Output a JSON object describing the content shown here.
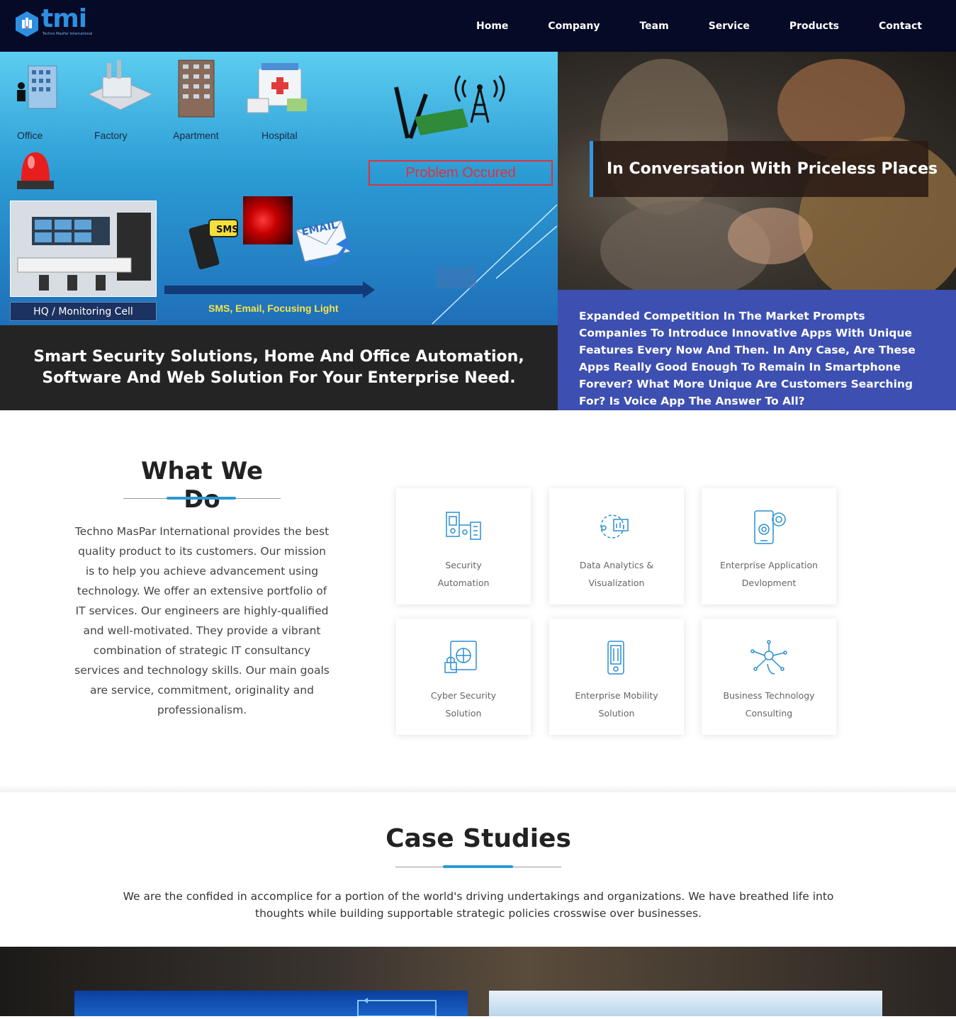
{
  "nav": {
    "logo_text": "tmi",
    "logo_tagline": "Techno MasPar International",
    "items": [
      {
        "label": "Home"
      },
      {
        "label": "Company"
      },
      {
        "label": "Team"
      },
      {
        "label": "Service"
      },
      {
        "label": "Products"
      },
      {
        "label": "Contact"
      }
    ]
  },
  "hero": {
    "diagram": {
      "buildings": [
        "Office",
        "Factory",
        "Apartment",
        "Hospital"
      ],
      "problem": "Problem Occured",
      "hq_label": "HQ / Monitoring Cell",
      "sms": "SMS",
      "email": "EMAIL",
      "alert_label": "SMS, Email, Focusing Light"
    },
    "caption": "Smart Security Solutions, Home And Office Automation, Software And Web Solution For Your Enterprise Need.",
    "side_title": "In Conversation With Priceless Places",
    "side_text": "Expanded Competition In The Market Prompts Companies To Introduce Innovative Apps With Unique Features Every Now And Then. In Any Case, Are These Apps Really Good Enough To Remain In Smartphone Forever? What More Unique Are Customers Searching For? Is Voice App The Answer To All?"
  },
  "what_we_do": {
    "title": "What We Do",
    "text": "Techno MasPar International provides the best quality product to its customers. Our mission is to help you achieve advancement using technology. We offer an extensive portfolio of IT services. Our engineers are highly-qualified and well-motivated. They provide a vibrant combination of strategic IT consultancy services and technology skills. Our main goals are service, commitment, originality and professionalism.",
    "services": [
      {
        "line1": "Security",
        "line2": "Automation",
        "icon": "security-automation-icon"
      },
      {
        "line1": "Data Analytics &",
        "line2": "Visualization",
        "icon": "data-analytics-icon"
      },
      {
        "line1": "Enterprise Application",
        "line2": "Devlopment",
        "icon": "enterprise-application-icon"
      },
      {
        "line1": "Cyber Security",
        "line2": "Solution",
        "icon": "cyber-security-icon"
      },
      {
        "line1": "Enterprise Mobility",
        "line2": "Solution",
        "icon": "enterprise-mobility-icon"
      },
      {
        "line1": "Business Technology",
        "line2": "Consulting",
        "icon": "business-technology-icon"
      }
    ]
  },
  "case_studies": {
    "title": "Case Studies",
    "text": "We are the confided in accomplice for a portion of the world's driving undertakings and organizations. We have breathed life into thoughts while building supportable strategic policies crosswise over businesses."
  },
  "colors": {
    "nav_bg": "#050a26",
    "accent": "#2a99d6",
    "panel_blue": "#3d4fb0",
    "caption_bg": "#242424"
  }
}
